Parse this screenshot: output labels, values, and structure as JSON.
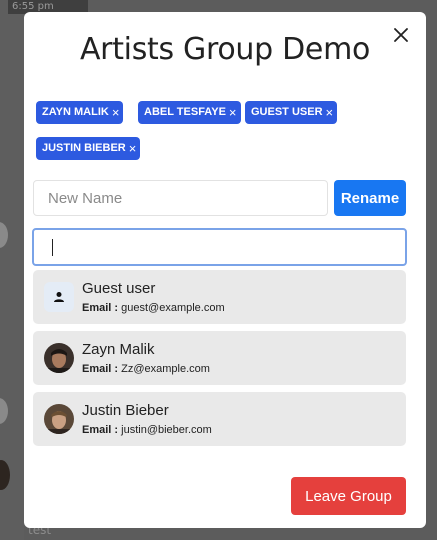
{
  "background": {
    "time_text": "6:55 pm",
    "bottom_text": "test"
  },
  "modal": {
    "title": "Artists Group Demo",
    "close_icon": "close-icon"
  },
  "chips": [
    {
      "label": "ZAYN MALIK",
      "remove": "×"
    },
    {
      "label": "ABEL TESFAYE",
      "remove": "×"
    },
    {
      "label": "GUEST USER",
      "remove": "×"
    },
    {
      "label": "JUSTIN BIEBER",
      "remove": "×"
    }
  ],
  "rename": {
    "placeholder": "New Name",
    "value": "",
    "button_label": "Rename"
  },
  "search": {
    "value": ""
  },
  "results": [
    {
      "name": "Guest user",
      "email_label": "Email :",
      "email": "guest@example.com",
      "avatar": "user-icon"
    },
    {
      "name": "Zayn Malik",
      "email_label": "Email :",
      "email": "Zz@example.com",
      "avatar": "photo"
    },
    {
      "name": "Justin Bieber",
      "email_label": "Email :",
      "email": "justin@bieber.com",
      "avatar": "photo"
    }
  ],
  "footer": {
    "leave_label": "Leave Group"
  },
  "colors": {
    "chip": "#2d5ae0",
    "primary": "#1877f2",
    "danger": "#e5403d",
    "result_bg": "#e9e9e9"
  }
}
